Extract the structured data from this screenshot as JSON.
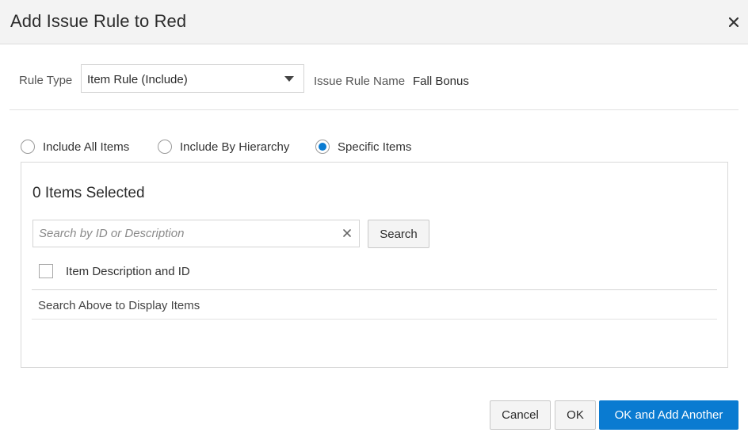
{
  "dialog": {
    "title": "Add Issue Rule to Red",
    "close_icon": "close-icon"
  },
  "form": {
    "rule_type_label": "Rule Type",
    "rule_type_value": "Item Rule (Include)",
    "issue_rule_name_label": "Issue Rule Name",
    "issue_rule_name_value": "Fall Bonus"
  },
  "scope": {
    "options": [
      {
        "label": "Include All Items",
        "checked": false
      },
      {
        "label": "Include By Hierarchy",
        "checked": false
      },
      {
        "label": "Specific Items",
        "checked": true
      }
    ]
  },
  "items_panel": {
    "count_text": "0 Items Selected",
    "search_placeholder": "Search by ID or Description",
    "search_value": "",
    "search_button": "Search",
    "column_header": "Item Description and ID",
    "empty_message": "Search Above to Display Items"
  },
  "footer": {
    "cancel_label": "Cancel",
    "ok_label": "OK",
    "ok_add_label": "OK and Add Another"
  },
  "colors": {
    "accent": "#0a7bd1",
    "header_bg": "#f3f3f3"
  }
}
